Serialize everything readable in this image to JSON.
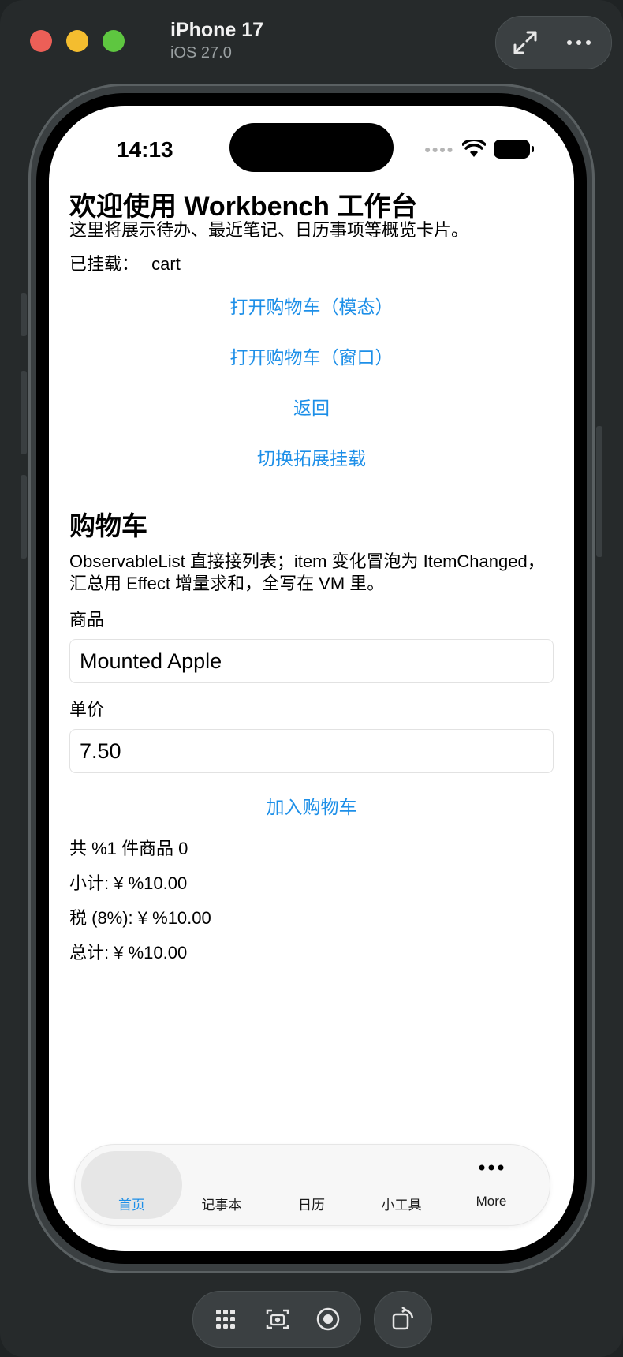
{
  "simulator": {
    "device_name": "iPhone 17",
    "os_version": "iOS 27.0"
  },
  "status_bar": {
    "time": "14:13"
  },
  "home": {
    "title": "欢迎使用 Workbench 工作台",
    "subtitle": "这里将展示待办、最近笔记、日历事项等概览卡片。",
    "mounted_label": "已挂载：",
    "mounted_value": "cart",
    "buttons": {
      "open_cart_modal": "打开购物车（模态）",
      "open_cart_window": "打开购物车（窗口）",
      "back": "返回",
      "toggle_extension": "切换拓展挂载"
    }
  },
  "cart": {
    "title": "购物车",
    "description": "ObservableList 直接接列表；item 变化冒泡为 ItemChanged，汇总用 Effect 增量求和，全写在 VM 里。",
    "product_label": "商品",
    "product_value": "Mounted Apple",
    "price_label": "单价",
    "price_value": "7.50",
    "add_button": "加入购物车",
    "count_text": "共 %1 件商品 0",
    "subtotal_text": "小计: ¥ %10.00",
    "tax_text": "税 (8%): ¥ %10.00",
    "total_text": "总计: ¥ %10.00"
  },
  "tabbar": {
    "items": [
      {
        "label": "首页",
        "active": true
      },
      {
        "label": "记事本",
        "active": false
      },
      {
        "label": "日历",
        "active": false
      },
      {
        "label": "小工具",
        "active": false
      },
      {
        "label": "More",
        "active": false
      }
    ],
    "more_icon": "ellipsis-icon"
  },
  "colors": {
    "accent": "#1d8fe8",
    "tabbar_bg": "#f7f7f7",
    "window_bg": "#262a2b"
  }
}
